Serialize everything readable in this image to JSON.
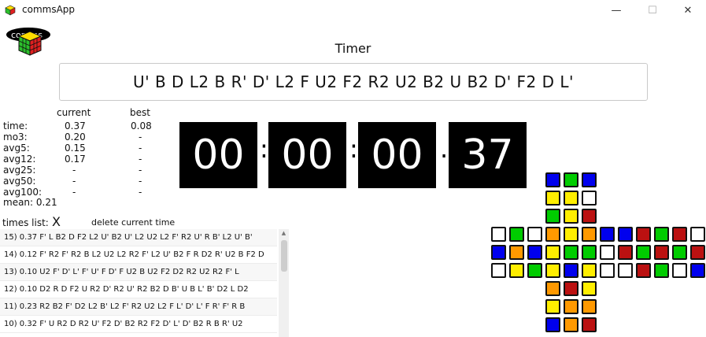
{
  "window": {
    "title": "commsApp",
    "min": "—",
    "max": "☐",
    "close": "✕"
  },
  "logo_text": "comms",
  "timer_label": "Timer",
  "scramble": "U' B  D  L2 B  R' D' L2 F  U2 F2 R2 U2 B2 U  B2 D' F2 D  L'",
  "stats": {
    "headers": {
      "current": "current",
      "best": "best"
    },
    "rows": [
      {
        "label": "time:",
        "current": "0.37",
        "best": "0.08"
      },
      {
        "label": "mo3:",
        "current": "0.20",
        "best": "-"
      },
      {
        "label": "avg5:",
        "current": "0.15",
        "best": "-"
      },
      {
        "label": "avg12:",
        "current": "0.17",
        "best": "-"
      },
      {
        "label": "avg25:",
        "current": "-",
        "best": "-"
      },
      {
        "label": "avg50:",
        "current": "-",
        "best": "-"
      },
      {
        "label": "avg100:",
        "current": "-",
        "best": "-"
      }
    ],
    "mean": "mean: 0.21"
  },
  "clock": {
    "hours": "00",
    "minutes": "00",
    "seconds": "00",
    "hundredths": "37",
    "sep1": ":",
    "sep2": ":",
    "sep3": "."
  },
  "times_list": {
    "label": "times list:",
    "clear": "X",
    "delete_current": "delete current time",
    "items": [
      "15) 0.37 F' L  B2 D  F2 L2 U' B2 U' L2 U2 L2 F' R2 U' R  B' L2 U' B'",
      "14) 0.12 F' R2 F' R2 B  L2 U2 L2 R2 F' L2 U' B2 F  R  D2 R' U2 B  F2 D",
      "13) 0.10 U2 F' D' L' F' U' F  D' F  U2 B  U2 F2 D2 R2 U2 R2 F' L",
      "12) 0.10 D2 R  D  F2 U  R2 D' R2 U' R2 B2 D  B' U  B  L' B' D2 L  D2",
      "11) 0.23 R2 B2 F' D2 L2 B' L2 F' R2 U2 L2 F  L' D' L' F  R' F' R  B",
      "10) 0.32 F' U  R2 D  R2 U' F2 D' B2 R2 F2 D' L' D' B2 R  B  R' U2"
    ]
  },
  "cube_colors": {
    "W": "#ffffff",
    "Y": "#ffee00",
    "G": "#00cc00",
    "B": "#0000ee",
    "R": "#bb1111",
    "O": "#ff9900"
  },
  "cube_net": {
    "U": [
      [
        "B",
        "G",
        "B"
      ],
      [
        "Y",
        "Y",
        "W"
      ],
      [
        "G",
        "Y",
        "R"
      ]
    ],
    "L": [
      [
        "W",
        "G",
        "W"
      ],
      [
        "B",
        "O",
        "B"
      ],
      [
        "W",
        "Y",
        "G"
      ]
    ],
    "F": [
      [
        "O",
        "Y",
        "O"
      ],
      [
        "Y",
        "G",
        "G"
      ],
      [
        "Y",
        "B",
        "Y"
      ]
    ],
    "R": [
      [
        "B",
        "B",
        "R"
      ],
      [
        "W",
        "R",
        "G"
      ],
      [
        "W",
        "W",
        "R"
      ]
    ],
    "Bk": [
      [
        "G",
        "R",
        "W"
      ],
      [
        "R",
        "G",
        "R"
      ],
      [
        "G",
        "W",
        "B"
      ]
    ],
    "D": [
      [
        "O",
        "R",
        "Y"
      ],
      [
        "Y",
        "O",
        "O"
      ],
      [
        "B",
        "O",
        "R"
      ]
    ]
  }
}
